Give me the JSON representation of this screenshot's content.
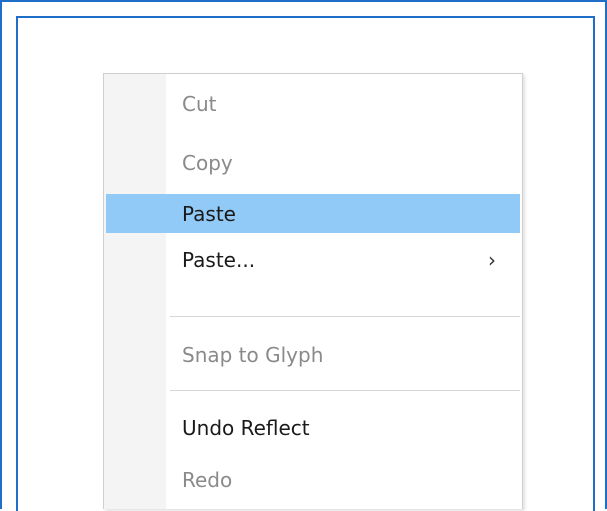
{
  "context_menu": {
    "items": [
      {
        "label": "Cut",
        "state": "disabled"
      },
      {
        "label": "Copy",
        "state": "disabled"
      },
      {
        "label": "Paste",
        "state": "highlighted"
      },
      {
        "label": "Paste...",
        "state": "enabled",
        "submenu_glyph": "›"
      },
      {
        "label": "Snap to Glyph",
        "state": "disabled"
      },
      {
        "label": "Undo Reflect",
        "state": "enabled"
      },
      {
        "label": "Redo",
        "state": "disabled"
      }
    ]
  },
  "colors": {
    "frame_border": "#1f6fc9",
    "highlight": "#91c9f7",
    "disabled_text": "#8a8a8a",
    "enabled_text": "#1a1a1a"
  }
}
